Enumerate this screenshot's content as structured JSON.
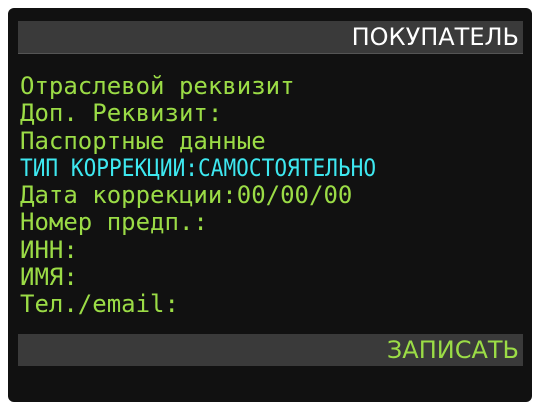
{
  "header": {
    "title": "ПОКУПАТЕЛЬ"
  },
  "fields": [
    {
      "label": "Отраслевой реквизит",
      "value": ""
    },
    {
      "label": "Доп. Реквизит:",
      "value": ""
    },
    {
      "label": "Паспортные данные",
      "value": ""
    },
    {
      "label": "ТИП КОРРЕКЦИИ:",
      "value": "САМОСТОЯТЕЛЬНО"
    },
    {
      "label": "Дата коррекции:",
      "value": "00/00/00"
    },
    {
      "label": "Номер предп.:",
      "value": ""
    },
    {
      "label": "ИНН:",
      "value": ""
    },
    {
      "label": "ИМЯ:",
      "value": ""
    },
    {
      "label": "Тел./email:",
      "value": ""
    }
  ],
  "footer": {
    "save_label": "ЗАПИСАТЬ"
  },
  "colors": {
    "background": "#111111",
    "bar": "#3a3a3a",
    "text_green": "#9bdc46",
    "text_cyan_selected": "#3ee8f0",
    "text_white": "#ffffff"
  }
}
